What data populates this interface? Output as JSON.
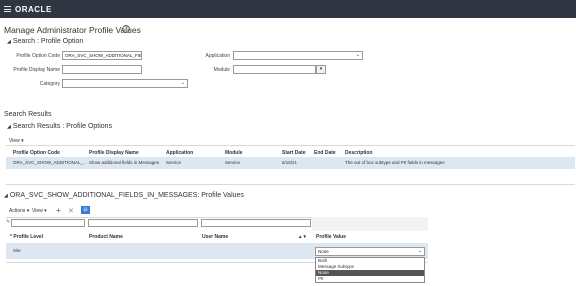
{
  "header": {
    "brand": "ORACLE"
  },
  "page": {
    "title": "Manage Administrator Profile Values",
    "help_glyph": "?"
  },
  "search": {
    "title": "Search : Profile Option",
    "profile_option_code_label": "Profile Option Code",
    "profile_option_code_value": "ORA_SVC_SHOW_ADDITIONAL_FIE",
    "profile_display_name_label": "Profile Display Name",
    "profile_display_name_value": "",
    "category_label": "Category",
    "category_value": "",
    "application_label": "Application",
    "application_value": "",
    "module_label": "Module",
    "module_value": ""
  },
  "results": {
    "heading": "Search Results",
    "title": "Search Results : Profile Options",
    "view_menu": "View",
    "columns": [
      "Profile Option Code",
      "Profile Display Name",
      "Application",
      "Module",
      "Start Date",
      "End Date",
      "Description"
    ],
    "rows": [
      {
        "code": "ORA_SVC_SHOW_ADDITIONAL_...",
        "display_name": "Show additional fields in Messages",
        "application": "Service",
        "module": "Service",
        "start_date": "6/18/21",
        "end_date": "",
        "description": "The out of box subtype and PII fields in messages"
      }
    ]
  },
  "values": {
    "title": "ORA_SVC_SHOW_ADDITIONAL_FIELDS_IN_MESSAGES: Profile Values",
    "actions_menu": "Actions",
    "view_menu": "View",
    "columns": [
      "Profile Level",
      "Product Name",
      "User Name",
      "Profile Value"
    ],
    "required_marker": "*",
    "rows": [
      {
        "level": "Site",
        "product": "",
        "user": "",
        "value": "None"
      }
    ],
    "dropdown_options": [
      "Both",
      "Message Subtype",
      "None",
      "PII"
    ],
    "dropdown_selected": "None"
  }
}
